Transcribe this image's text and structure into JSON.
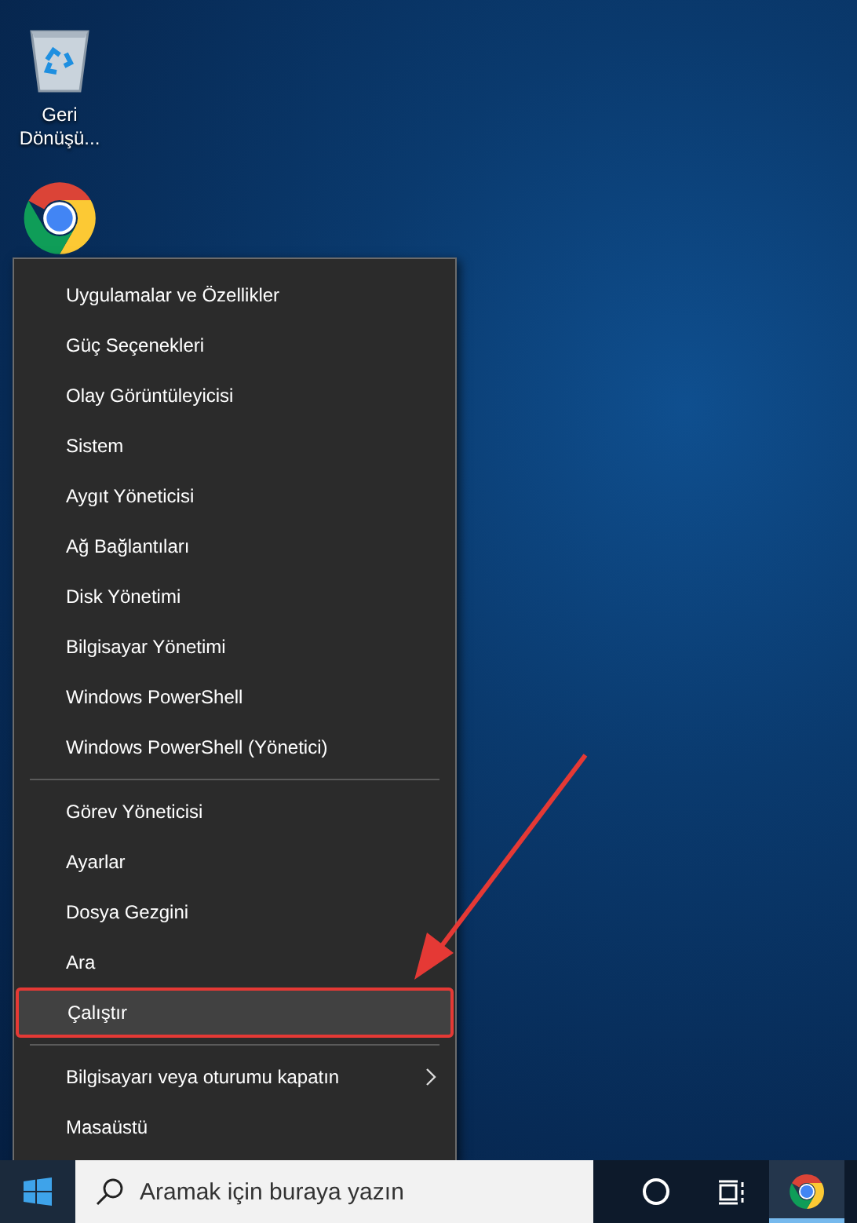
{
  "desktop": {
    "icons": [
      {
        "kind": "recycle-bin",
        "label": "Geri Dönüşü..."
      },
      {
        "kind": "browser"
      }
    ]
  },
  "menu": {
    "groups": [
      [
        {
          "label": "Uygulamalar ve Özellikler",
          "selected": false
        },
        {
          "label": "Güç Seçenekleri",
          "selected": false
        },
        {
          "label": "Olay Görüntüleyicisi",
          "selected": false
        },
        {
          "label": "Sistem",
          "selected": false
        },
        {
          "label": "Aygıt Yöneticisi",
          "selected": false
        },
        {
          "label": "Ağ Bağlantıları",
          "selected": false
        },
        {
          "label": "Disk Yönetimi",
          "selected": false
        },
        {
          "label": "Bilgisayar Yönetimi",
          "selected": false
        },
        {
          "label": "Windows PowerShell",
          "selected": false
        },
        {
          "label": "Windows PowerShell (Yönetici)",
          "selected": false
        }
      ],
      [
        {
          "label": "Görev Yöneticisi",
          "selected": false
        },
        {
          "label": "Ayarlar",
          "selected": false
        },
        {
          "label": "Dosya Gezgini",
          "selected": false
        },
        {
          "label": "Ara",
          "selected": false
        },
        {
          "label": "Çalıştır",
          "selected": true
        }
      ],
      [
        {
          "label": "Bilgisayarı veya oturumu kapatın",
          "selected": false,
          "submenu": true
        },
        {
          "label": "Masaüstü",
          "selected": false
        }
      ]
    ]
  },
  "taskbar": {
    "search": {
      "placeholder": "Aramak için buraya yazın"
    },
    "pinned": [
      {
        "kind": "cortana",
        "running": false
      },
      {
        "kind": "task-view",
        "running": false
      },
      {
        "kind": "browser",
        "running": true
      }
    ]
  }
}
